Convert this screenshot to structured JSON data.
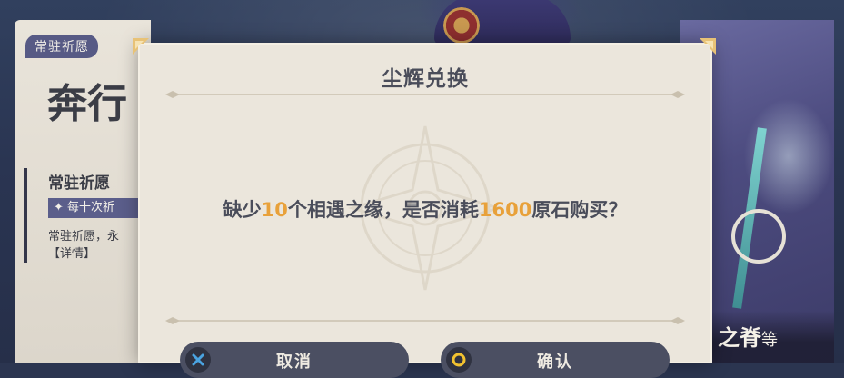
{
  "banner": {
    "tag": "常驻祈愿",
    "title": "奔行",
    "subtitle": "常驻祈愿",
    "chip": "✦ 每十次祈",
    "description": "常驻祈愿，永",
    "details_link": "【详情】"
  },
  "character": {
    "name": "之脊",
    "name_suffix": "等"
  },
  "dialog": {
    "title": "尘辉兑换",
    "message": {
      "prefix": "缺少",
      "missing_count": "10",
      "middle": "个相遇之缘，是否消耗",
      "cost": "1600",
      "suffix": "原石购买？"
    },
    "cancel_label": "取消",
    "confirm_label": "确认",
    "cancel_icon": "x-close-icon",
    "confirm_icon": "circle-confirm-icon"
  },
  "colors": {
    "highlight": "#e8a13a",
    "dialog_bg": "#ebe6dc",
    "button_bg": "#4b4f62",
    "cancel_icon": "#4aa3e0",
    "confirm_icon": "#f2c230"
  }
}
